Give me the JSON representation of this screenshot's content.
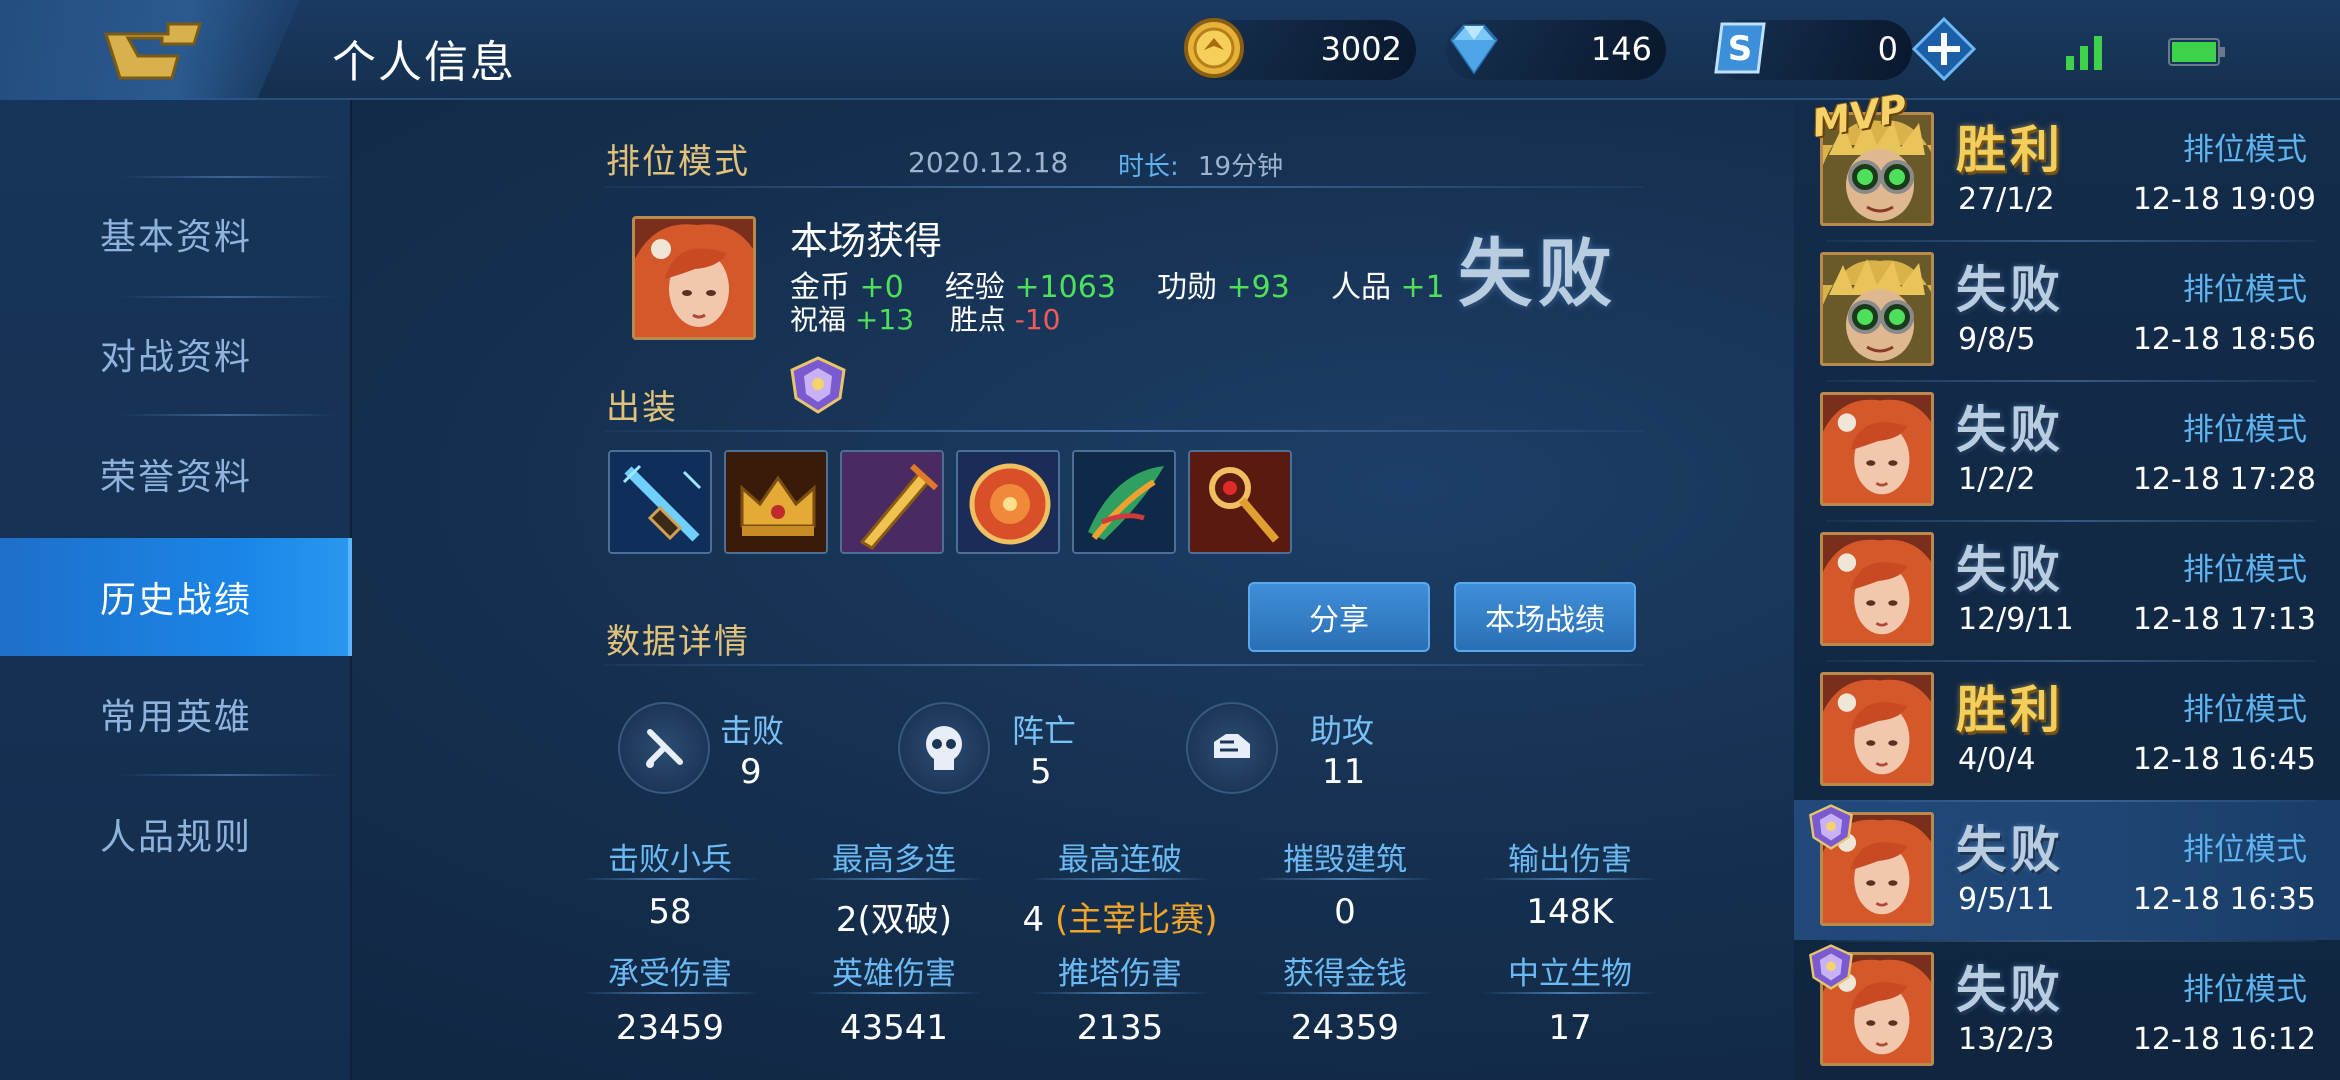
{
  "header": {
    "title": "个人信息",
    "currencies": [
      {
        "name": "gold-coin-icon",
        "amount": "3002",
        "color": "#e8b33a"
      },
      {
        "name": "diamond-icon",
        "amount": "146",
        "color": "#7cc8f8"
      },
      {
        "name": "s-coupon-icon",
        "amount": "0",
        "color": "#4aa6ee"
      }
    ]
  },
  "sidebar": {
    "items": [
      {
        "label": "基本资料"
      },
      {
        "label": "对战资料"
      },
      {
        "label": "荣誉资料"
      },
      {
        "label": "历史战绩",
        "active": true
      },
      {
        "label": "常用英雄"
      },
      {
        "label": "人品规则"
      }
    ]
  },
  "match": {
    "mode": "排位模式",
    "date": "2020.12.18",
    "duration_label": "时长:",
    "duration": "19分钟",
    "gained_title": "本场获得",
    "rewards": {
      "gold_label": "金币",
      "gold": "+0",
      "exp_label": "经验",
      "exp": "+1063",
      "merit_label": "功勋",
      "merit": "+93",
      "char_label": "人品",
      "char": "+1",
      "blessing_label": "祝福",
      "blessing": "+13",
      "winpoint_label": "胜点",
      "winpoint": "-10"
    },
    "result": "失败",
    "equipment_title": "出装",
    "equipment": [
      {
        "name": "item-1-icon",
        "color": "#2c7fd0"
      },
      {
        "name": "item-2-icon",
        "color": "#e0a23a"
      },
      {
        "name": "item-3-icon",
        "color": "#c98a2a"
      },
      {
        "name": "item-4-icon",
        "color": "#d94f2a"
      },
      {
        "name": "item-5-icon",
        "color": "#30a060"
      },
      {
        "name": "item-6-icon",
        "color": "#c23520"
      }
    ],
    "share_label": "分享",
    "record_label": "本场战绩",
    "details_title": "数据详情",
    "kda": {
      "kill_label": "击败",
      "kills": "9",
      "death_label": "阵亡",
      "deaths": "5",
      "assist_label": "助攻",
      "assists": "11"
    },
    "stats": [
      {
        "label": "击败小兵",
        "value": "58"
      },
      {
        "label": "最高多连",
        "value": "2(双破)"
      },
      {
        "label": "最高连破",
        "value": "4",
        "highlight": "(主宰比赛)"
      },
      {
        "label": "摧毁建筑",
        "value": "0"
      },
      {
        "label": "输出伤害",
        "value": "148K"
      },
      {
        "label": "承受伤害",
        "value": "23459"
      },
      {
        "label": "英雄伤害",
        "value": "43541"
      },
      {
        "label": "推塔伤害",
        "value": "2135"
      },
      {
        "label": "获得金钱",
        "value": "24359"
      },
      {
        "label": "中立生物",
        "value": "17"
      }
    ]
  },
  "history": {
    "mvp_label": "MVP",
    "rows": [
      {
        "result": "胜利",
        "win": true,
        "mode": "排位模式",
        "kda": "27/1/2",
        "time": "12-18 19:09",
        "hero": "green-goggles-hero"
      },
      {
        "result": "失败",
        "win": false,
        "mode": "排位模式",
        "kda": "9/8/5",
        "time": "12-18 18:56",
        "hero": "green-goggles-hero"
      },
      {
        "result": "失败",
        "win": false,
        "mode": "排位模式",
        "kda": "1/2/2",
        "time": "12-18 17:28",
        "hero": "red-hair-hero"
      },
      {
        "result": "失败",
        "win": false,
        "mode": "排位模式",
        "kda": "12/9/11",
        "time": "12-18 17:13",
        "hero": "red-hair-hero"
      },
      {
        "result": "胜利",
        "win": true,
        "mode": "排位模式",
        "kda": "4/0/4",
        "time": "12-18 16:45",
        "hero": "red-hair-hero"
      },
      {
        "result": "失败",
        "win": false,
        "mode": "排位模式",
        "kda": "9/5/11",
        "time": "12-18 16:35",
        "hero": "red-hair-hero",
        "selected": true
      },
      {
        "result": "失败",
        "win": false,
        "mode": "排位模式",
        "kda": "13/2/3",
        "time": "12-18 16:12",
        "hero": "red-hair-hero"
      }
    ]
  }
}
